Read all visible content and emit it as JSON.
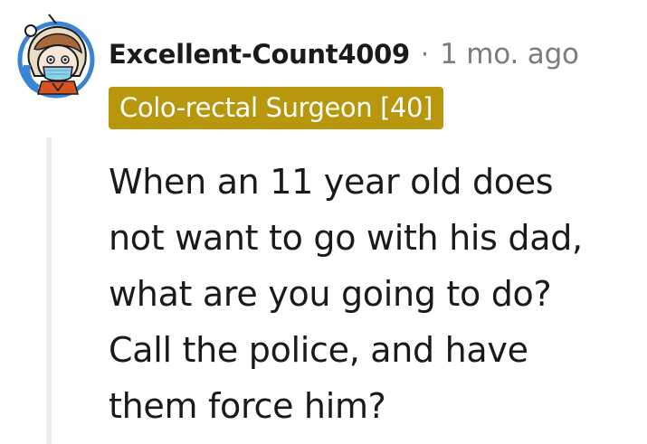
{
  "comment": {
    "author": "Excellent-Count4009",
    "separator": "·",
    "timestamp": "1 mo. ago",
    "flair": {
      "text": "Colo-rectal Surgeon [40]",
      "background_color": "#b8970d",
      "text_color": "#ffffff"
    },
    "avatar_icon": "snoo-avatar-icon",
    "body_lines": [
      "When an 11 year old does",
      "not want to go with his dad,",
      "what are you going to do?",
      "Call the police, and have",
      "them force him?"
    ]
  },
  "colors": {
    "text": "#1a1a1b",
    "muted": "#7c7c7c",
    "thread_line": "#ececec",
    "avatar_ring": "#3a84d4"
  }
}
